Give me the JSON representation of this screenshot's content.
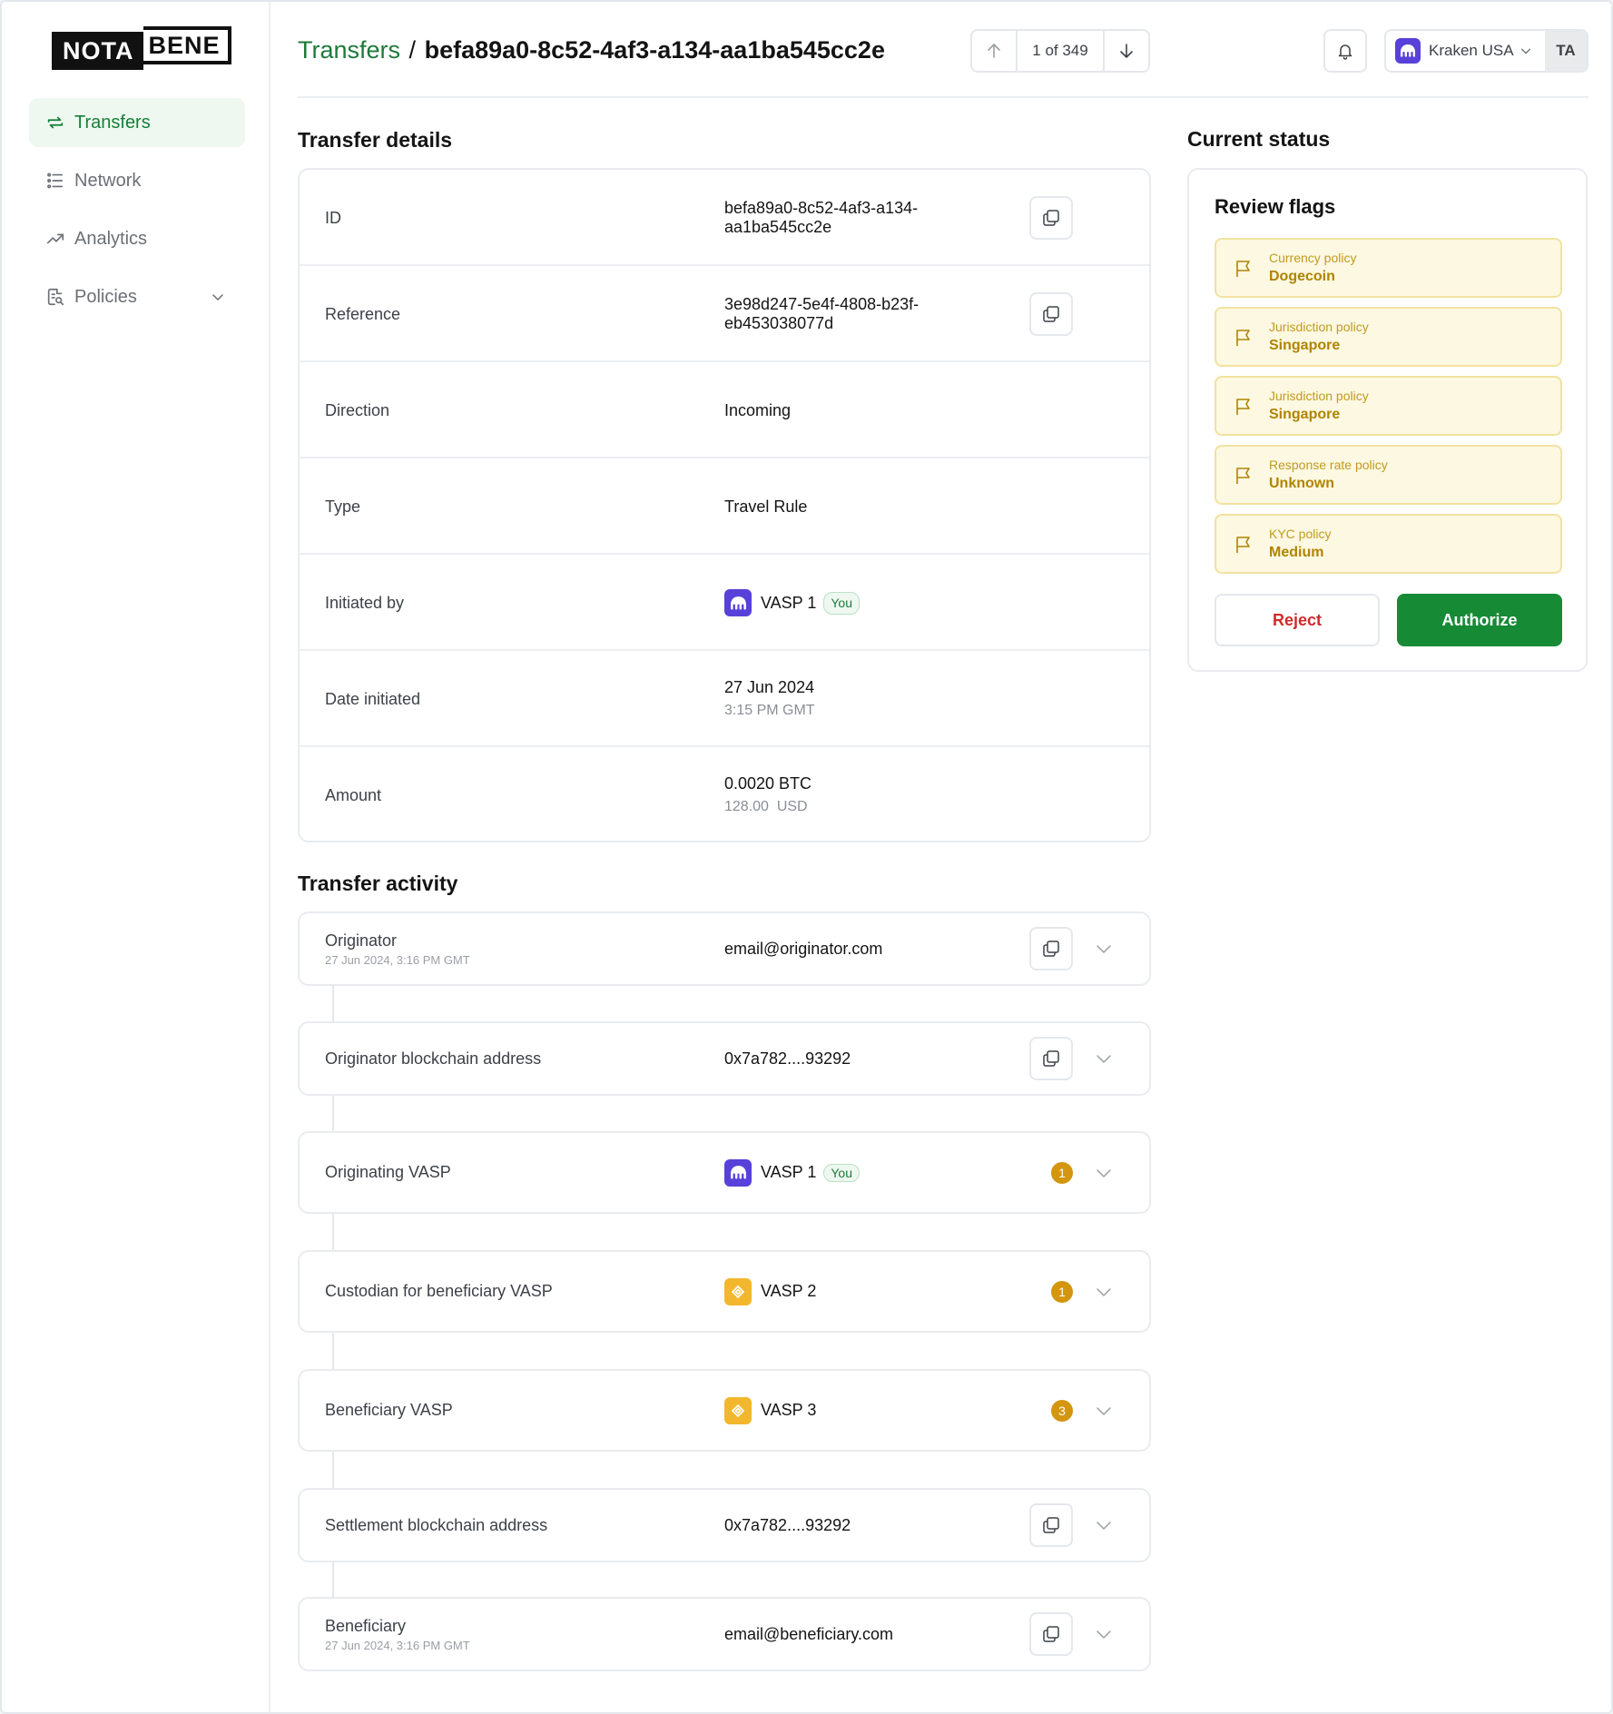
{
  "logo": {
    "left": "NOTA",
    "right": "BENE"
  },
  "sidebar": {
    "items": [
      {
        "label": "Transfers",
        "icon": "transfer-arrows-icon",
        "active": true
      },
      {
        "label": "Network",
        "icon": "list-icon"
      },
      {
        "label": "Analytics",
        "icon": "trend-up-icon"
      },
      {
        "label": "Policies",
        "icon": "document-search-icon"
      }
    ]
  },
  "header": {
    "breadcrumb_link": "Transfers",
    "separator": "/",
    "transfer_id": "befa89a0-8c52-4af3-a134-aa1ba545cc2e",
    "pager": "1 of 349",
    "org_name": "Kraken USA",
    "user_initials": "TA"
  },
  "details": {
    "title": "Transfer details",
    "rows": [
      {
        "label": "ID",
        "value": "befa89a0-8c52-4af3-a134-",
        "value2": "aa1ba545cc2e"
      },
      {
        "label": "Reference",
        "value": "3e98d247-5e4f-4808-b23f-",
        "value2": "eb453038077d"
      },
      {
        "label": "Direction",
        "value": "Incoming"
      },
      {
        "label": "Type",
        "value": "Travel Rule"
      },
      {
        "label": "Initiated by",
        "value": "VASP 1",
        "badge": "You"
      },
      {
        "label": "Date initiated",
        "value": "27 Jun 2024",
        "sub": "3:15 PM GMT"
      },
      {
        "label": "Amount",
        "value": "0.0020 BTC",
        "sub": "128.00  USD"
      }
    ]
  },
  "activity": {
    "title": "Transfer activity",
    "rows": [
      {
        "label": "Originator",
        "sub": "27 Jun 2024, 3:16 PM GMT",
        "value": "email@originator.com"
      },
      {
        "label": "Originator blockchain address",
        "value": "0x7a782....93292"
      },
      {
        "label": "Originating VASP",
        "value": "VASP 1",
        "badge": "You",
        "count": "1"
      },
      {
        "label": "Custodian for beneficiary VASP",
        "value": "VASP 2",
        "count": "1"
      },
      {
        "label": "Beneficiary VASP",
        "value": "VASP 3",
        "count": "3"
      },
      {
        "label": "Settlement blockchain address",
        "value": "0x7a782....93292"
      },
      {
        "label": "Beneficiary",
        "sub": "27 Jun 2024, 3:16 PM GMT",
        "value": "email@beneficiary.com"
      }
    ]
  },
  "status": {
    "title": "Current status",
    "review_title": "Review flags",
    "flags": [
      {
        "type": "Currency policy",
        "value": "Dogecoin"
      },
      {
        "type": "Jurisdiction policy",
        "value": "Singapore"
      },
      {
        "type": "Jurisdiction policy",
        "value": "Singapore"
      },
      {
        "type": "Response rate policy",
        "value": "Unknown"
      },
      {
        "type": "KYC policy",
        "value": "Medium"
      }
    ],
    "reject_label": "Reject",
    "authorize_label": "Authorize"
  },
  "colors": {
    "brand_green": "#178a35",
    "link_green": "#1d7a3a",
    "flag_bg": "#fdf8e1",
    "flag_text": "#b08400",
    "reject_red": "#d12a2a",
    "vasp_purple": "#5741d9",
    "vasp_yellow": "#f3b72e"
  }
}
